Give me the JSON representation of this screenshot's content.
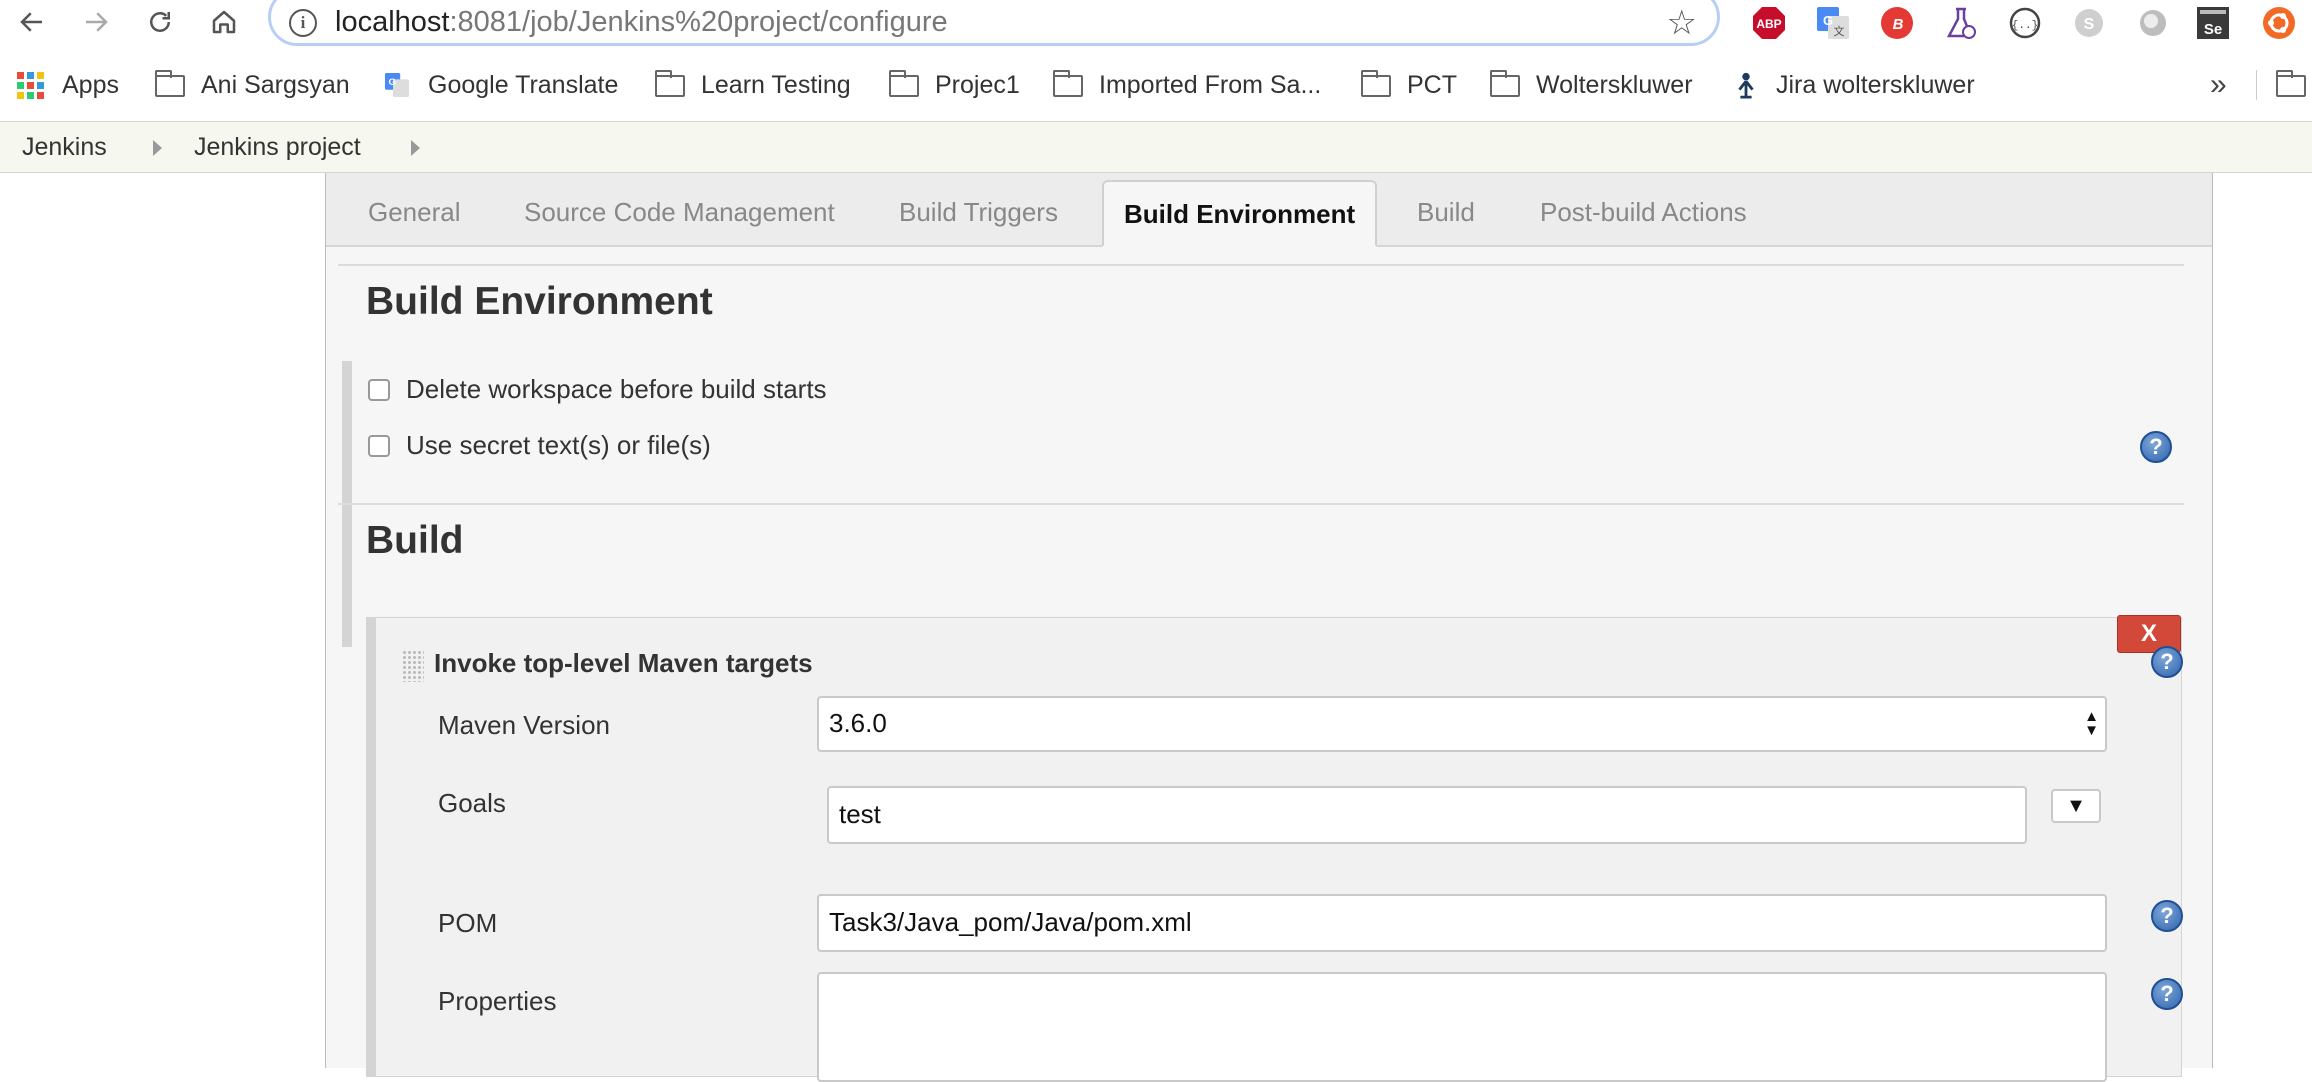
{
  "browser": {
    "url_host": "localhost",
    "url_rest": ":8081/job/Jenkins%20project/configure"
  },
  "bookmarks": [
    {
      "label": "Apps",
      "icon": "apps-grid-icon"
    },
    {
      "label": "Ani Sargsyan",
      "icon": "folder-icon"
    },
    {
      "label": "Google Translate",
      "icon": "google-translate-icon"
    },
    {
      "label": "Learn Testing",
      "icon": "folder-icon"
    },
    {
      "label": "Projec1",
      "icon": "folder-icon"
    },
    {
      "label": "Imported From Sa...",
      "icon": "folder-icon"
    },
    {
      "label": "PCT",
      "icon": "folder-icon"
    },
    {
      "label": "Wolterskluwer",
      "icon": "folder-icon"
    },
    {
      "label": "Jira wolterskluwer",
      "icon": "jira-icon"
    }
  ],
  "breadcrumbs": [
    "Jenkins",
    "Jenkins project"
  ],
  "tabs": [
    "General",
    "Source Code Management",
    "Build Triggers",
    "Build Environment",
    "Build",
    "Post-build Actions"
  ],
  "active_tab": "Build Environment",
  "build_environment": {
    "title": "Build Environment",
    "options": [
      "Delete workspace before build starts",
      "Use secret text(s) or file(s)"
    ]
  },
  "build": {
    "title": "Build",
    "step": {
      "title": "Invoke top-level Maven targets",
      "delete_label": "X",
      "fields": {
        "maven_version": {
          "label": "Maven Version",
          "value": "3.6.0"
        },
        "goals": {
          "label": "Goals",
          "value": "test",
          "expand_glyph": "▼"
        },
        "pom": {
          "label": "POM",
          "value": "Task3/Java_pom/Java/pom.xml"
        },
        "properties": {
          "label": "Properties",
          "value": ""
        }
      }
    }
  },
  "help_glyph": "?",
  "extensions": [
    "adblock-plus-icon",
    "google-translate-icon",
    "extension-red-icon",
    "flask-icon",
    "json-viewer-icon",
    "skype-icon",
    "circle-extension-icon",
    "selenium-icon",
    "ubuntu-icon"
  ],
  "colors": {
    "delete_button": "#d24939",
    "help_icon": "#2e64ad",
    "active_tab_text": "#111111",
    "inactive_tab_text": "#888888"
  }
}
